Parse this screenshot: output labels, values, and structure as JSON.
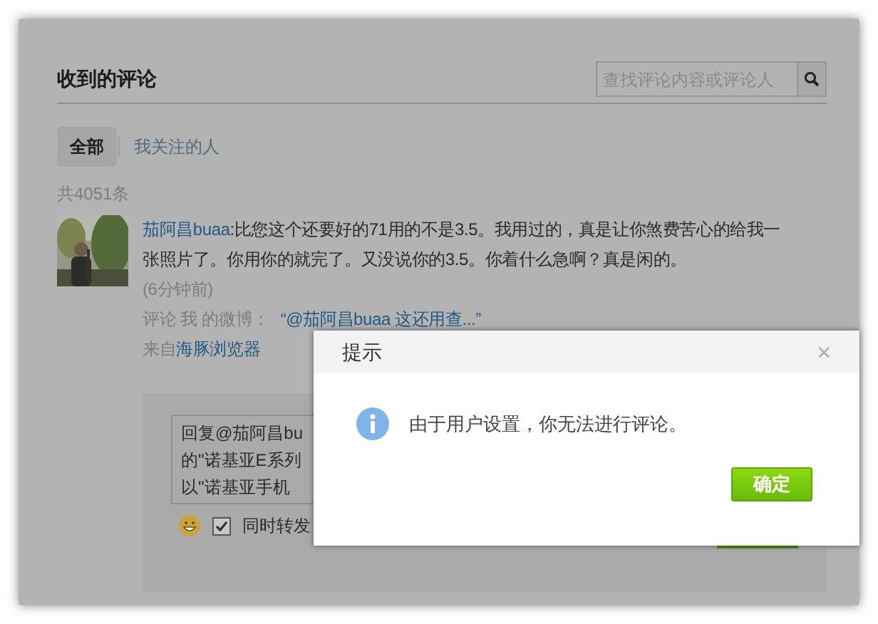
{
  "page": {
    "title": "收到的评论",
    "search": {
      "placeholder": "查找评论内容或评论人"
    },
    "tabs": [
      {
        "label": "全部",
        "selected": true
      },
      {
        "label": "我关注的人",
        "selected": false
      }
    ],
    "total": "共4051条",
    "comments": [
      {
        "author": "茄阿昌buaa",
        "text": ":比您这个还要好的71用的不是3.5。我用过的，真是让你煞费苦心的给我一张照片了。你用你的就完了。又没说你的3.5。你着什么急啊？真是闲的。",
        "time": "(6分钟前)",
        "context_label": "评论 我 的微博：",
        "context_link": "“@茄阿昌buaa 这还用查...”",
        "source_label": "来自",
        "source_link": "海豚浏览器"
      }
    ],
    "reply": {
      "lines": [
        "回复@茄阿昌bu",
        "的\"诺基亚E系列",
        "以\"诺基亚手机"
      ],
      "repost_label": "同时转发",
      "repost_checked": true
    }
  },
  "dialog": {
    "title": "提示",
    "close": "×",
    "message": "由于用户设置，你无法进行评论。",
    "ok": "确定"
  }
}
